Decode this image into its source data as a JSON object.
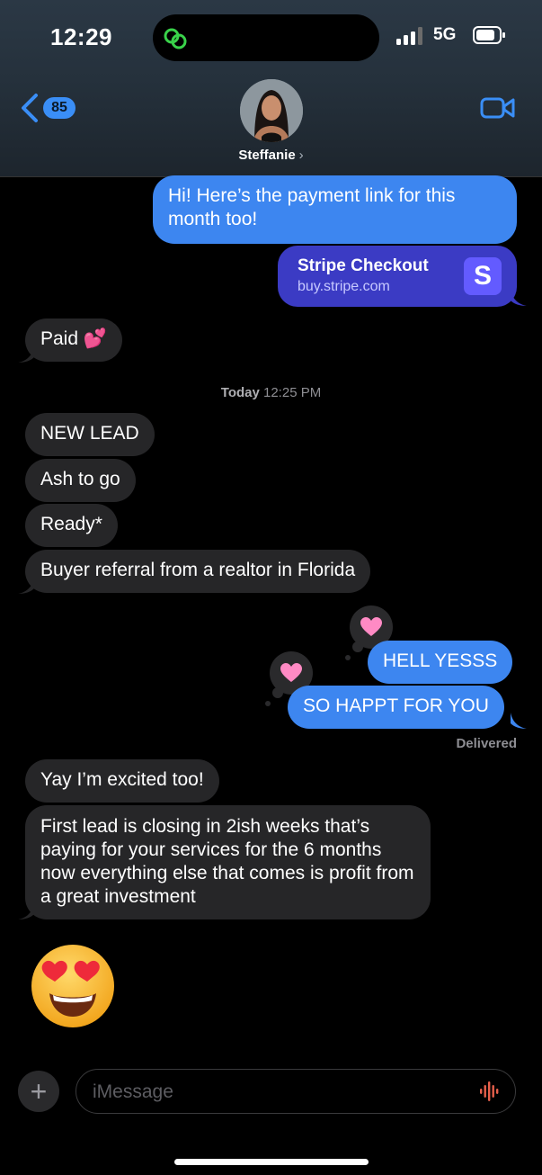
{
  "status_bar": {
    "time": "12:29",
    "network": "5G"
  },
  "header": {
    "back_count": "85",
    "contact_name": "Steffanie",
    "contact_chevron": "›"
  },
  "messages": {
    "m1": "Hi! Here’s the payment link for this month too!",
    "link_title": "Stripe Checkout",
    "link_url": "buy.stripe.com",
    "link_logo": "S",
    "m2": "Paid 💕",
    "timestamp_day": "Today",
    "timestamp_time": "12:25 PM",
    "m3": "NEW LEAD",
    "m4": "Ash to go",
    "m5": "Ready*",
    "m6": "Buyer referral from a realtor in Florida",
    "m7": "HELL YESSS",
    "m8": "SO HAPPT FOR YOU",
    "delivered": "Delivered",
    "m9": "Yay I’m excited too!",
    "m10": "First lead is closing in 2ish weeks that’s paying for your services for the 6 months now everything else that comes is profit from a great investment"
  },
  "input": {
    "placeholder": "iMessage",
    "plus": "+"
  },
  "colors": {
    "sent": "#3d86f0",
    "received": "#262628",
    "accent": "#3a8ef6",
    "stripe": "#635bff"
  },
  "icons": [
    "back-chevron-icon",
    "video-camera-icon",
    "heart-icon",
    "heart-eyes-emoji",
    "plus-icon",
    "audio-waveform-icon"
  ]
}
